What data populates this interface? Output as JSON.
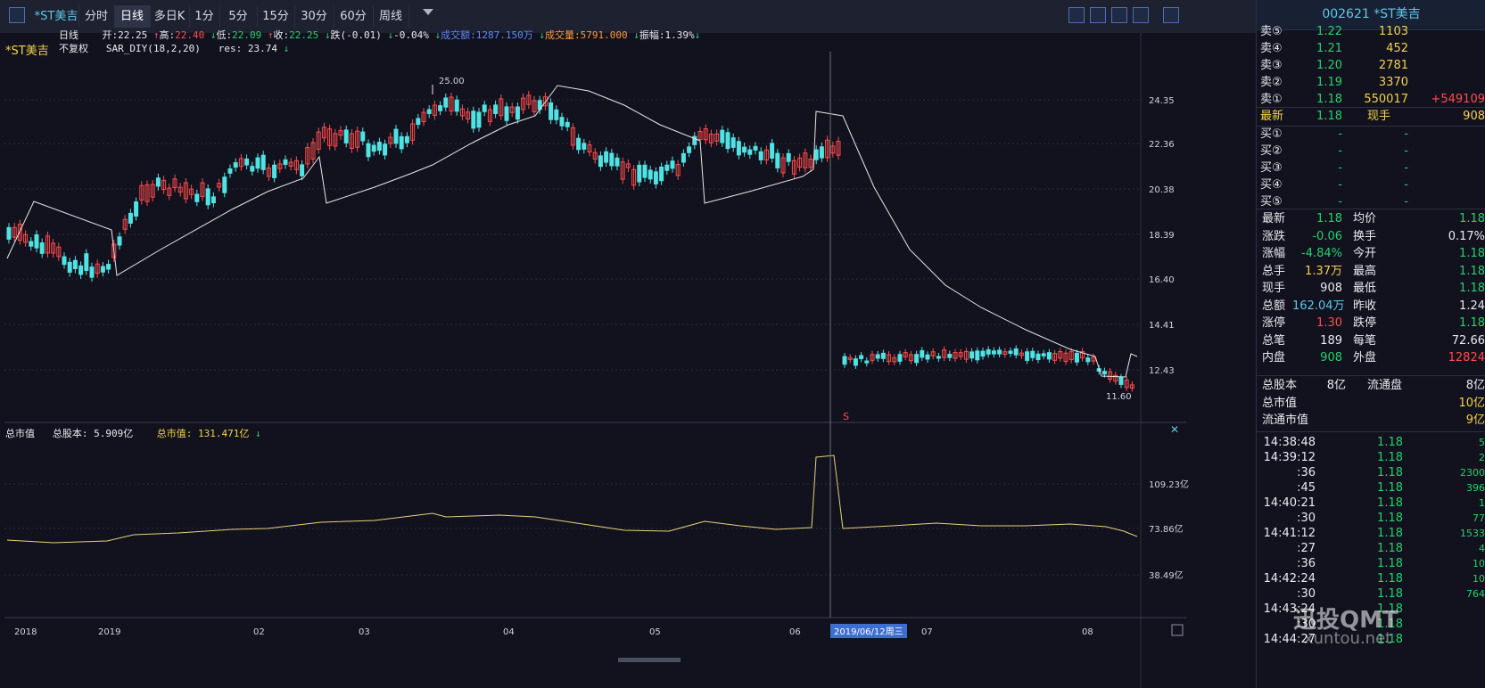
{
  "toolbar": {
    "symbol_tab": "*ST美吉",
    "periods": [
      "分时",
      "日线",
      "多日K",
      "1分",
      "5分",
      "15分",
      "30分",
      "60分",
      "周线"
    ],
    "active_period": "日线"
  },
  "main_info": {
    "symbol": "*ST美吉",
    "period": "日线",
    "adjust": "不复权",
    "open_label": "开:",
    "open": "22.25",
    "high_label": "高:",
    "high": "22.40",
    "low_label": "低:",
    "low": "22.09",
    "close_label": "收:",
    "close": "22.25",
    "change_label": "跌(-0.01)",
    "change_pct": "-0.04%",
    "amount_label": "成交额:",
    "amount": "1287.150万",
    "volume_label": "成交量:",
    "volume": "5791.000",
    "amplitude_label": "振幅:",
    "amplitude": "1.39%",
    "indicator": "SAR_DIY(18,2,20)",
    "res_label": "res:",
    "res": "23.74"
  },
  "price_axis": [
    "24.35",
    "22.36",
    "20.38",
    "18.39",
    "16.40",
    "14.41",
    "12.43"
  ],
  "annot_high": "25.00",
  "annot_low": "11.60",
  "signal": "S",
  "sub_info": {
    "name": "总市值",
    "shares_label": "总股本:",
    "shares": "5.909亿",
    "mcap_label": "总市值:",
    "mcap": "131.471亿"
  },
  "sub_axis": [
    "109.23亿",
    "73.86亿",
    "38.49亿"
  ],
  "time_axis": [
    "2018",
    "2019",
    "02",
    "03",
    "04",
    "05",
    "06",
    "07",
    "08"
  ],
  "crosshair_date": "2019/06/12周三",
  "quote": {
    "code": "002621",
    "name": "*ST美吉",
    "asks": [
      {
        "label": "卖⑤",
        "price": "1.22",
        "vol": "1103"
      },
      {
        "label": "卖④",
        "price": "1.21",
        "vol": "452"
      },
      {
        "label": "卖③",
        "price": "1.20",
        "vol": "2781"
      },
      {
        "label": "卖②",
        "price": "1.19",
        "vol": "3370"
      },
      {
        "label": "卖①",
        "price": "1.18",
        "vol": "550017",
        "extra": "+549109"
      }
    ],
    "latest_label": "最新",
    "latest": "1.18",
    "hand_label": "现手",
    "hand": "908",
    "bids": [
      {
        "label": "买①",
        "price": "-",
        "vol": "-"
      },
      {
        "label": "买②",
        "price": "-",
        "vol": "-"
      },
      {
        "label": "买③",
        "price": "-",
        "vol": "-"
      },
      {
        "label": "买④",
        "price": "-",
        "vol": "-"
      },
      {
        "label": "买⑤",
        "price": "-",
        "vol": "-"
      }
    ],
    "stats": [
      {
        "l1": "最新",
        "v1": "1.18",
        "c1": "green",
        "l2": "均价",
        "v2": "1.18",
        "c2": "green"
      },
      {
        "l1": "涨跌",
        "v1": "-0.06",
        "c1": "green",
        "l2": "换手",
        "v2": "0.17%",
        "c2": "white"
      },
      {
        "l1": "涨幅",
        "v1": "-4.84%",
        "c1": "green",
        "l2": "今开",
        "v2": "1.18",
        "c2": "green"
      },
      {
        "l1": "总手",
        "v1": "1.37万",
        "c1": "yellow",
        "l2": "最高",
        "v2": "1.18",
        "c2": "green"
      },
      {
        "l1": "现手",
        "v1": "908",
        "c1": "white",
        "l2": "最低",
        "v2": "1.18",
        "c2": "green"
      },
      {
        "l1": "总额",
        "v1": "162.04万",
        "c1": "cyan",
        "l2": "昨收",
        "v2": "1.24",
        "c2": "white"
      },
      {
        "l1": "涨停",
        "v1": "1.30",
        "c1": "red",
        "l2": "跌停",
        "v2": "1.18",
        "c2": "green"
      },
      {
        "l1": "总笔",
        "v1": "189",
        "c1": "white",
        "l2": "每笔",
        "v2": "72.66",
        "c2": "white"
      },
      {
        "l1": "内盘",
        "v1": "908",
        "c1": "green",
        "l2": "外盘",
        "v2": "12824",
        "c2": "red"
      }
    ],
    "cap": [
      {
        "l1": "总股本",
        "v1": "8亿",
        "l2": "流通盘",
        "v2": "8亿"
      },
      {
        "l1": "总市值",
        "v1": "",
        "l2": "",
        "v2": "10亿"
      },
      {
        "l1": "流通市值",
        "v1": "",
        "l2": "",
        "v2": "9亿"
      }
    ],
    "ticks": [
      {
        "t": "14:38:48",
        "p": "1.18",
        "v": "5"
      },
      {
        "t": "14:39:12",
        "p": "1.18",
        "v": "2"
      },
      {
        "t": ":36",
        "p": "1.18",
        "v": "2300"
      },
      {
        "t": ":45",
        "p": "1.18",
        "v": "396"
      },
      {
        "t": "14:40:21",
        "p": "1.18",
        "v": "1"
      },
      {
        "t": ":30",
        "p": "1.18",
        "v": "77"
      },
      {
        "t": "14:41:12",
        "p": "1.18",
        "v": "1533"
      },
      {
        "t": ":27",
        "p": "1.18",
        "v": "4"
      },
      {
        "t": ":36",
        "p": "1.18",
        "v": "10"
      },
      {
        "t": "14:42:24",
        "p": "1.18",
        "v": "10"
      },
      {
        "t": ":30",
        "p": "1.18",
        "v": "764"
      },
      {
        "t": "14:43:24",
        "p": "1.18",
        "v": ""
      },
      {
        "t": ":30",
        "p": "1.18",
        "v": ""
      },
      {
        "t": "14:44:27",
        "p": "1.18",
        "v": ""
      }
    ]
  },
  "watermark": {
    "brand": "迅投QMT",
    "site": "xuntou.net"
  },
  "colors": {
    "up": "#ff4b4b",
    "down": "#50e3e3",
    "sar": "#e6e6e6",
    "mcap": "#e8d27a"
  }
}
